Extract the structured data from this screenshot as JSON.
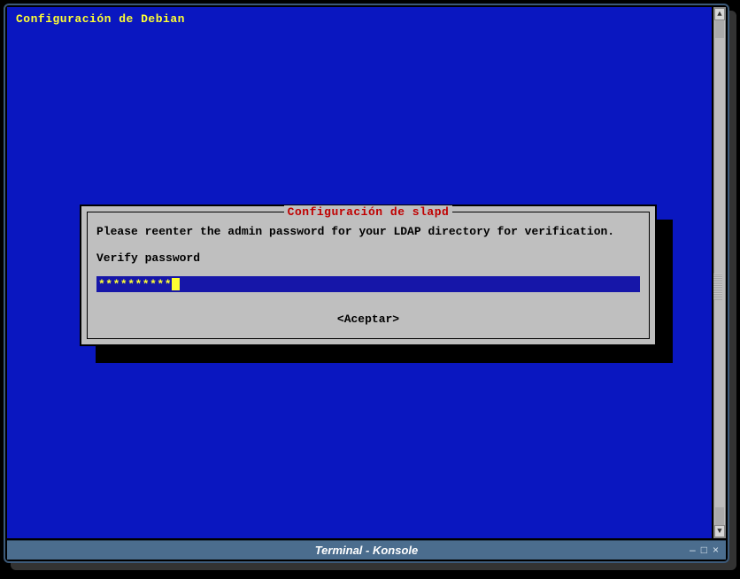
{
  "header": {
    "title": "Configuración de Debian"
  },
  "dialog": {
    "title_text": "Configuración de slapd",
    "instruction": "Please reenter the admin password for your LDAP directory for verification.",
    "field_label": "Verify password",
    "input_value": "**********",
    "accept_label": "<Aceptar>"
  },
  "statusbar": {
    "title": "Terminal - Konsole"
  },
  "window_controls": {
    "min": "–",
    "max": "□",
    "close": "×"
  },
  "scroll": {
    "up_glyph": "▲",
    "down_glyph": "▼"
  }
}
